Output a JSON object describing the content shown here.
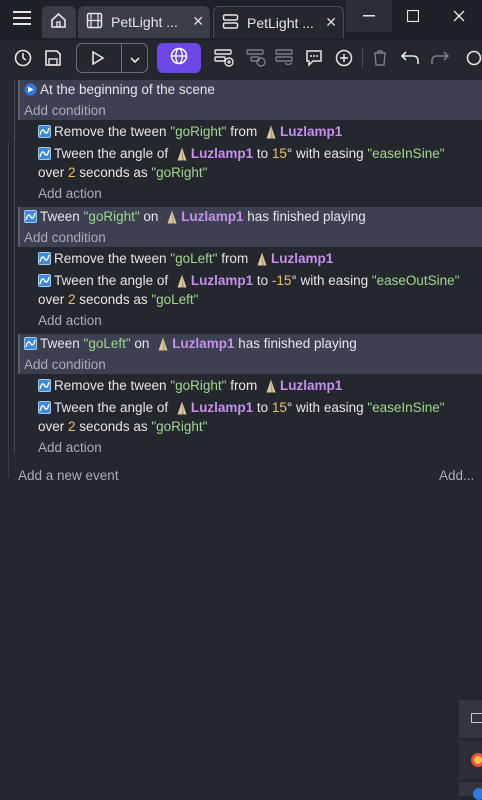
{
  "tabs": [
    {
      "label": "PetLight ...",
      "icon": "film-icon"
    },
    {
      "label": "PetLight ...",
      "icon": "events-icon"
    }
  ],
  "events": [
    {
      "condition": "At the beginning of the scene",
      "add_condition": "Add condition",
      "actions": [
        {
          "line1": [
            "Remove the tween ",
            {
              "s": "\"goRight\""
            },
            " from ",
            {
              "o": "Luzlamp1"
            }
          ]
        },
        {
          "line1": [
            "Tween the angle of ",
            {
              "o": "Luzlamp1"
            },
            " to ",
            {
              "n": "15"
            },
            "° with easing ",
            {
              "s": "\"easeInSine\""
            }
          ],
          "line2": [
            "over ",
            {
              "n": "2"
            },
            " seconds as ",
            {
              "s": "\"goRight\""
            }
          ]
        }
      ],
      "add_action": "Add action"
    },
    {
      "condition": [
        "Tween ",
        {
          "s": "\"goRight\""
        },
        " on ",
        {
          "o": "Luzlamp1"
        },
        " has finished playing"
      ],
      "add_condition": "Add condition",
      "actions": [
        {
          "line1": [
            "Remove the tween ",
            {
              "s": "\"goLeft\""
            },
            " from ",
            {
              "o": "Luzlamp1"
            }
          ]
        },
        {
          "line1": [
            "Tween the angle of ",
            {
              "o": "Luzlamp1"
            },
            " to ",
            {
              "n": "-15"
            },
            "° with easing ",
            {
              "s": "\"easeOutSine\""
            }
          ],
          "line2": [
            "over ",
            {
              "n": "2"
            },
            " seconds as ",
            {
              "s": "\"goLeft\""
            }
          ]
        }
      ],
      "add_action": "Add action"
    },
    {
      "condition": [
        "Tween ",
        {
          "s": "\"goLeft\""
        },
        " on ",
        {
          "o": "Luzlamp1"
        },
        " has finished playing"
      ],
      "add_condition": "Add condition",
      "actions": [
        {
          "line1": [
            "Remove the tween ",
            {
              "s": "\"goRight\""
            },
            " from ",
            {
              "o": "Luzlamp1"
            }
          ]
        },
        {
          "line1": [
            "Tween the angle of ",
            {
              "o": "Luzlamp1"
            },
            " to ",
            {
              "n": "15"
            },
            "° with easing ",
            {
              "s": "\"easeInSine\""
            }
          ],
          "line2": [
            "over ",
            {
              "n": "2"
            },
            " seconds as ",
            {
              "s": "\"goRight\""
            }
          ]
        }
      ],
      "add_action": "Add action"
    }
  ],
  "footer": {
    "add_event": "Add a new event",
    "add_more": "Add..."
  },
  "colors": {
    "accent": "#6d47e6",
    "string": "#9fd88f",
    "object": "#c98ef0",
    "number": "#f0c060"
  }
}
